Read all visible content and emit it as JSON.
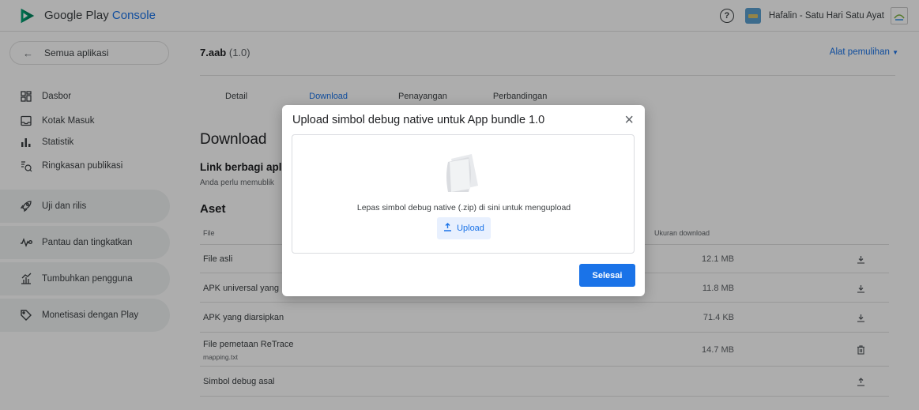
{
  "header": {
    "logo_text": "Google Play",
    "logo_accent": "Console",
    "developer_name": "Hafalin - Satu Hari Satu Ayat"
  },
  "sidebar": {
    "all_apps": "Semua aplikasi",
    "items": [
      {
        "label": "Dasbor",
        "icon": "dashboard-icon"
      },
      {
        "label": "Kotak Masuk",
        "icon": "inbox-icon"
      },
      {
        "label": "Statistik",
        "icon": "statistics-icon"
      },
      {
        "label": "Ringkasan publikasi",
        "icon": "publishing-overview-icon"
      }
    ],
    "groups": [
      {
        "label": "Uji dan rilis",
        "icon": "rocket-icon"
      },
      {
        "label": "Pantau dan tingkatkan",
        "icon": "monitor-icon"
      },
      {
        "label": "Tumbuhkan pengguna",
        "icon": "grow-icon"
      },
      {
        "label": "Monetisasi dengan Play",
        "icon": "tag-icon"
      }
    ]
  },
  "main": {
    "app_name": "7.aab",
    "app_version": "(1.0)",
    "recovery_label": "Alat pemulihan",
    "tabs": [
      "Detail",
      "Download",
      "Penayangan",
      "Perbandingan"
    ],
    "active_tab": "Download",
    "section_title": "Download",
    "share_title": "Link berbagi apli",
    "share_sub": "Anda perlu memublik",
    "assets_title": "Aset",
    "table": {
      "col_file": "File",
      "col_size": "Ukuran download",
      "rows": [
        {
          "name": "File asli",
          "sub": "",
          "size": "12.1 MB",
          "action": "download-icon"
        },
        {
          "name": "APK universal yang",
          "sub": "",
          "size": "11.8 MB",
          "action": "download-icon"
        },
        {
          "name": "APK yang diarsipkan",
          "sub": "",
          "size": "71.4 KB",
          "action": "download-icon"
        },
        {
          "name": "File pemetaan ReTrace",
          "sub": "mapping.txt",
          "size": "14.7 MB",
          "action": "delete-icon"
        },
        {
          "name": "Simbol debug asal",
          "sub": "",
          "size": "",
          "action": "upload-icon"
        }
      ]
    }
  },
  "dialog": {
    "title": "Upload simbol debug native untuk App bundle 1.0",
    "drop_text": "Lepas simbol debug native (.zip) di sini untuk mengupload",
    "upload_label": "Upload",
    "done_label": "Selesai"
  },
  "colors": {
    "accent": "#1a73e8",
    "sidebar_group_bg": "#f1f3f4",
    "scrim": "rgba(0,0,0,0.32)"
  }
}
